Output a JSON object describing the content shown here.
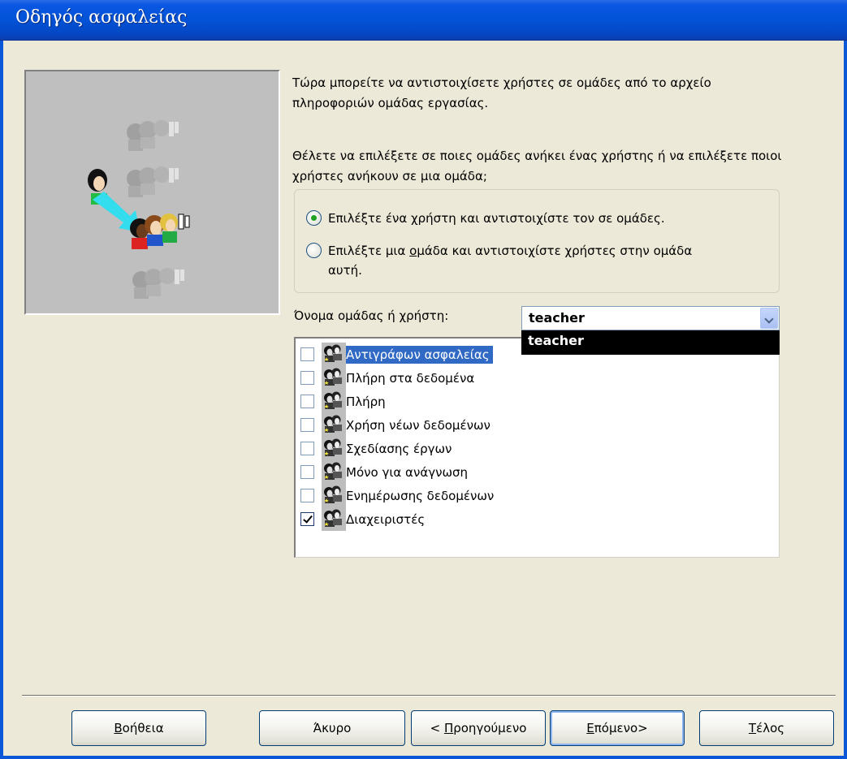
{
  "window": {
    "title": "Οδηγός ασφαλείας"
  },
  "instructions": {
    "intro": "Τώρα μπορείτε να αντιστοιχίσετε χρήστες σε ομάδες από το αρχείο πληροφοριών ομάδας εργασίας.",
    "question": "Θέλετε να επιλέξετε σε ποιες ομάδες ανήκει ένας χρήστης ή να επιλέξετε ποιοι χρήστες ανήκουν σε μια ομάδα;"
  },
  "options": {
    "user_to_groups": {
      "before": "Επιλέξτε ένα ",
      "accel": "χ",
      "after": "ρήστη και αντιστοιχίστε τον σε ομάδες.",
      "selected": true
    },
    "group_to_users": {
      "before": "Επιλέξτε μια ",
      "accel": "ο",
      "after": "μάδα και αντιστοιχίστε χρήστες στην ομάδα αυτή.",
      "selected": false
    }
  },
  "name_field": {
    "label": "Όνομα ομάδας ή χρήστη:",
    "value": "teacher",
    "dropdown_items": [
      "teacher"
    ]
  },
  "groups": [
    {
      "label": "Αντιγράφων ασφαλείας",
      "checked": false,
      "selected": true
    },
    {
      "label": "Πλήρη στα δεδομένα",
      "checked": false,
      "selected": false
    },
    {
      "label": "Πλήρη",
      "checked": false,
      "selected": false
    },
    {
      "label": "Χρήση νέων δεδομένων",
      "checked": false,
      "selected": false
    },
    {
      "label": "Σχεδίασης έργων",
      "checked": false,
      "selected": false
    },
    {
      "label": "Μόνο για ανάγνωση",
      "checked": false,
      "selected": false
    },
    {
      "label": "Ενημέρωσης δεδομένων",
      "checked": false,
      "selected": false
    },
    {
      "label": "Διαχειριστές",
      "checked": true,
      "selected": false
    }
  ],
  "buttons": {
    "help": {
      "accel": "Β",
      "rest": "οήθεια"
    },
    "cancel": "Άκυρο",
    "back": {
      "prefix": "< ",
      "accel": "Π",
      "rest": "ροηγούμενο"
    },
    "next": {
      "accel": "Ε",
      "rest": "πόμενο>"
    },
    "finish": {
      "accel": "Τ",
      "rest": "έλος"
    }
  },
  "colors": {
    "titlebar": "#0354d8",
    "selection": "#316ac5",
    "dialog_bg": "#ece9d8",
    "arrow": "#33ddee"
  }
}
